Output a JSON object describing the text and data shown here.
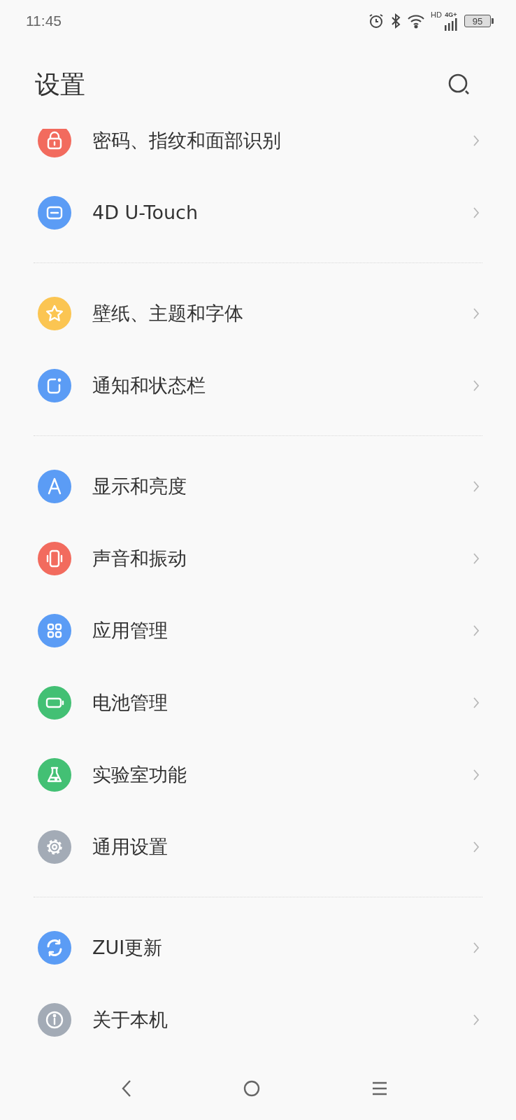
{
  "status_bar": {
    "time": "11:45",
    "hd": "HD",
    "network": "4G+",
    "battery": "95"
  },
  "header": {
    "title": "设置"
  },
  "sections": [
    {
      "items": [
        {
          "label": "密码、指纹和面部识别",
          "kind": "lock",
          "color": "#f26b5e"
        },
        {
          "label": "4D U-Touch",
          "kind": "touch",
          "color": "#5b9cf5"
        }
      ]
    },
    {
      "items": [
        {
          "label": "壁纸、主题和字体",
          "kind": "star",
          "color": "#fbc552"
        },
        {
          "label": "通知和状态栏",
          "kind": "notice",
          "color": "#5b9cf5"
        }
      ]
    },
    {
      "items": [
        {
          "label": "显示和亮度",
          "kind": "display",
          "color": "#5b9cf5"
        },
        {
          "label": "声音和振动",
          "kind": "vibrate",
          "color": "#f26b5e"
        },
        {
          "label": "应用管理",
          "kind": "apps",
          "color": "#5b9cf5"
        },
        {
          "label": "电池管理",
          "kind": "battery",
          "color": "#43c074"
        },
        {
          "label": "实验室功能",
          "kind": "flask",
          "color": "#43c074"
        },
        {
          "label": "通用设置",
          "kind": "gear",
          "color": "#a3abb6"
        }
      ]
    },
    {
      "items": [
        {
          "label": "ZUI更新",
          "kind": "refresh",
          "color": "#5b9cf5"
        },
        {
          "label": "关于本机",
          "kind": "info",
          "color": "#a3abb6"
        }
      ]
    }
  ]
}
